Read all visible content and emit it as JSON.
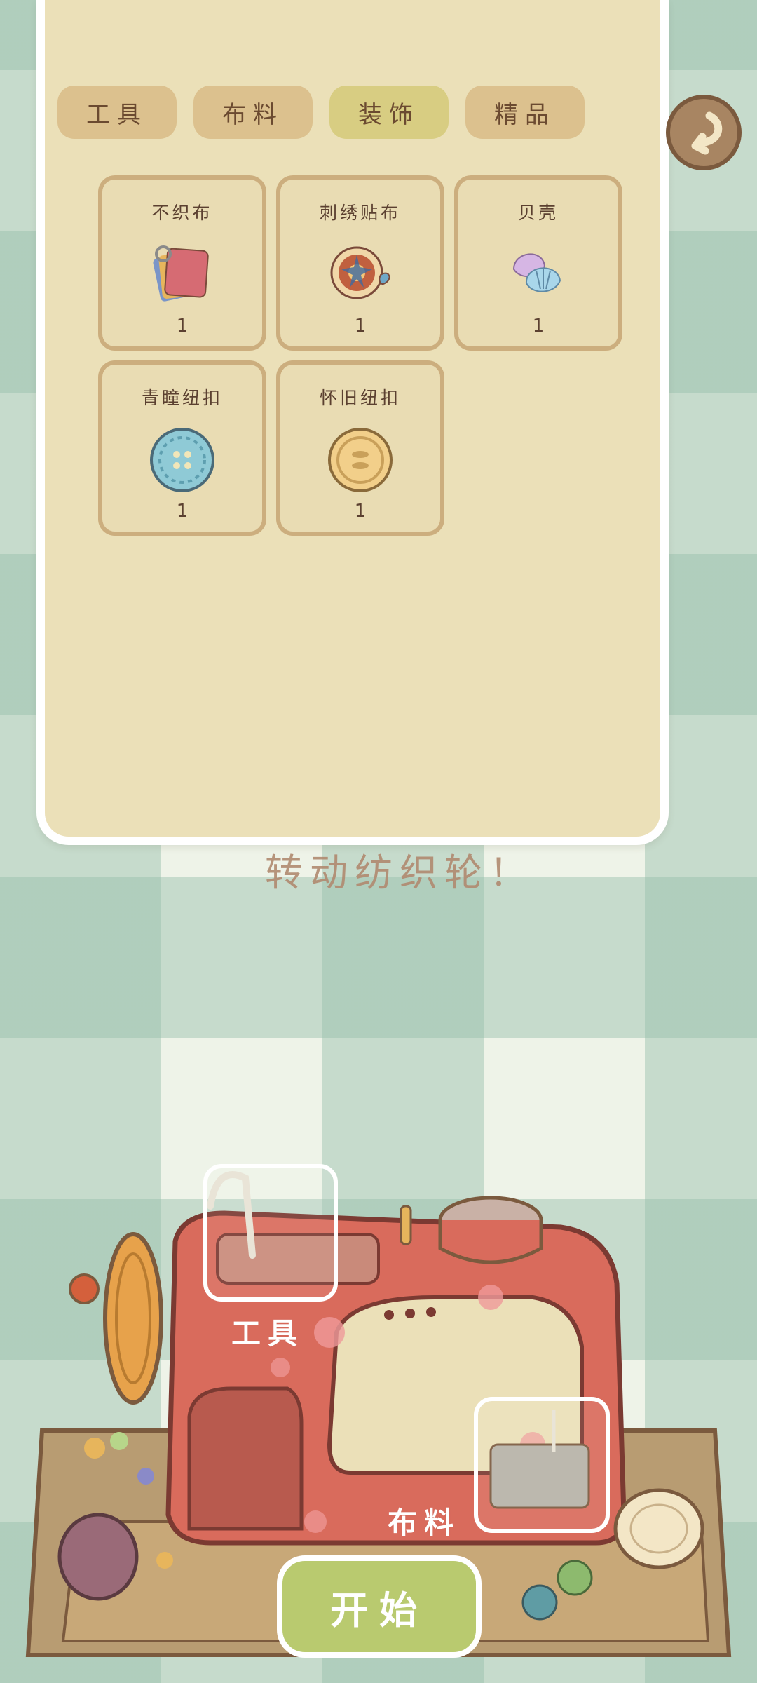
{
  "tabs": [
    {
      "label": "工具",
      "active": false
    },
    {
      "label": "布料",
      "active": false
    },
    {
      "label": "装饰",
      "active": true
    },
    {
      "label": "精品",
      "active": false
    }
  ],
  "items": [
    {
      "name": "不织布",
      "count": "1",
      "icon": "felt-cloth-icon"
    },
    {
      "name": "刺绣贴布",
      "count": "1",
      "icon": "embroidery-patch-icon"
    },
    {
      "name": "贝壳",
      "count": "1",
      "icon": "shell-icon"
    },
    {
      "name": "青瞳纽扣",
      "count": "1",
      "icon": "blue-button-icon"
    },
    {
      "name": "怀旧纽扣",
      "count": "1",
      "icon": "vintage-button-icon"
    }
  ],
  "hint_text": "转动纺织轮！",
  "machine": {
    "tool_slot_label": "工具",
    "fabric_slot_label": "布料",
    "start_label": "开始"
  },
  "colors": {
    "panel_bg": "#ebe0b8",
    "tab_bg": "#dcc18e",
    "tab_active_bg": "#d8cd82",
    "card_border": "#ccae7e",
    "machine_red": "#d96b5c",
    "start_green": "#b9ca6f"
  }
}
